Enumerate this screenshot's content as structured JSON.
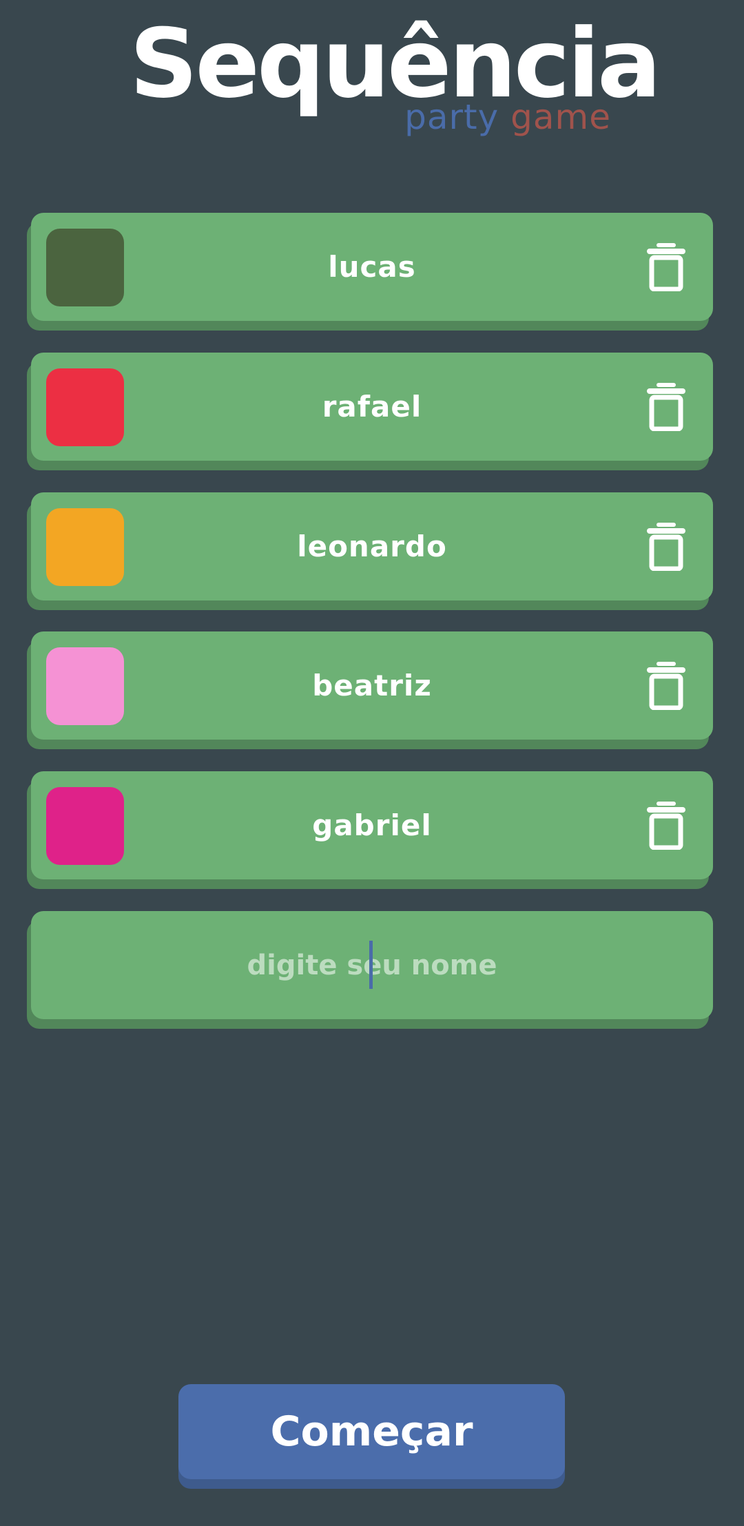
{
  "logo": {
    "title": "Sequência",
    "subtitle_word1": "party",
    "subtitle_word2": "game"
  },
  "players": [
    {
      "name": "lucas",
      "color": "#4b643f"
    },
    {
      "name": "rafael",
      "color": "#ec2f43"
    },
    {
      "name": "leonardo",
      "color": "#f3a623"
    },
    {
      "name": "beatriz",
      "color": "#f592d4"
    },
    {
      "name": "gabriel",
      "color": "#df2289"
    }
  ],
  "input": {
    "placeholder": "digite seu nome",
    "value": ""
  },
  "start_button": {
    "label": "Começar"
  },
  "icons": {
    "delete": "trash-icon"
  },
  "colors": {
    "background": "#39474e",
    "card": "#6db175",
    "card_shadow": "#52875a",
    "button": "#4b6dab",
    "subtitle_blue": "#4a6ca9",
    "subtitle_red": "#a0534c"
  }
}
